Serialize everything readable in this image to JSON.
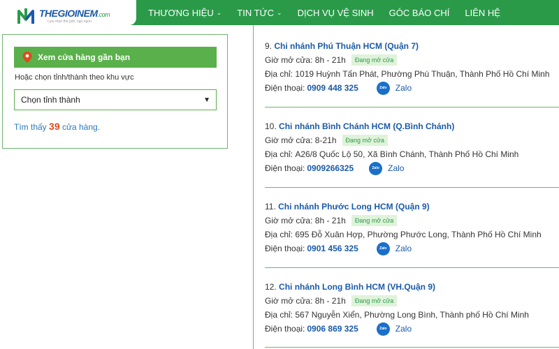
{
  "header": {
    "logo_main": "THEGIOINEM",
    "logo_suffix": ".com",
    "logo_tagline": "Lựa chọn thế giới, ngủ ngon",
    "nav": [
      {
        "label": "THƯƠNG HIỆU",
        "has_dropdown": true
      },
      {
        "label": "TIN TỨC",
        "has_dropdown": true
      },
      {
        "label": "DỊCH VỤ VỆ SINH",
        "has_dropdown": false
      },
      {
        "label": "GÓC BÁO CHÍ",
        "has_dropdown": false
      },
      {
        "label": "LIÊN HỆ",
        "has_dropdown": false
      }
    ]
  },
  "finder": {
    "near_button": "Xem cửa hàng gần bạn",
    "region_label": "Hoặc chọn tỉnh/thành theo khu vực",
    "select_value": "Chọn tỉnh thành",
    "found_prefix": "Tìm thấy",
    "found_count": "39",
    "found_suffix": "cửa hàng."
  },
  "stores": [
    {
      "index": "9.",
      "name": "Chi nhánh Phú Thuận HCM (Quận 7)",
      "hours_label": "Giờ mở cửa:",
      "hours": "8h - 21h",
      "status": "Đang mở cửa",
      "address_label": "Địa chỉ:",
      "address": "1019 Huỳnh Tấn Phát, Phường Phú Thuận, Thành Phố Hồ Chí Minh",
      "phone_label": "Điện thoại:",
      "phone": "0909 448 325",
      "zalo": "Zalo"
    },
    {
      "index": "10.",
      "name": "Chi nhánh Bình Chánh HCM (Q.Bình Chánh)",
      "hours_label": "Giờ mở cửa:",
      "hours": "8-21h",
      "status": "Đang mở cửa",
      "address_label": "Địa chỉ:",
      "address": "A26/8 Quốc Lộ 50, Xã Bình Chánh, Thành Phố Hồ Chí Minh",
      "phone_label": "Điện thoại:",
      "phone": "0909266325",
      "zalo": "Zalo"
    },
    {
      "index": "11.",
      "name": "Chi nhánh Phước Long HCM (Quận 9)",
      "hours_label": "Giờ mở cửa:",
      "hours": "8h - 21h",
      "status": "Đang mở cửa",
      "address_label": "Địa chỉ:",
      "address": "695 Đỗ Xuân Hợp, Phường Phước Long, Thành Phố Hồ Chí Minh",
      "phone_label": "Điện thoại:",
      "phone": "0901 456 325",
      "zalo": "Zalo"
    },
    {
      "index": "12.",
      "name": "Chi nhánh Long Bình HCM (VH.Quận 9)",
      "hours_label": "Giờ mở cửa:",
      "hours": "8h - 21h",
      "status": "Đang mở cửa",
      "address_label": "Địa chỉ:",
      "address": "567 Nguyễn Xiển, Phường Long Bình, Thành phố Hồ Chí Minh",
      "phone_label": "Điện thoại:",
      "phone": "0906 869 325",
      "zalo": "Zalo"
    }
  ],
  "icons": {
    "zalo_icon_text": "Zalo"
  },
  "colors": {
    "brand_green": "#2a9a49",
    "link_blue": "#1a5aa8",
    "count_orange": "#e04a1a"
  }
}
